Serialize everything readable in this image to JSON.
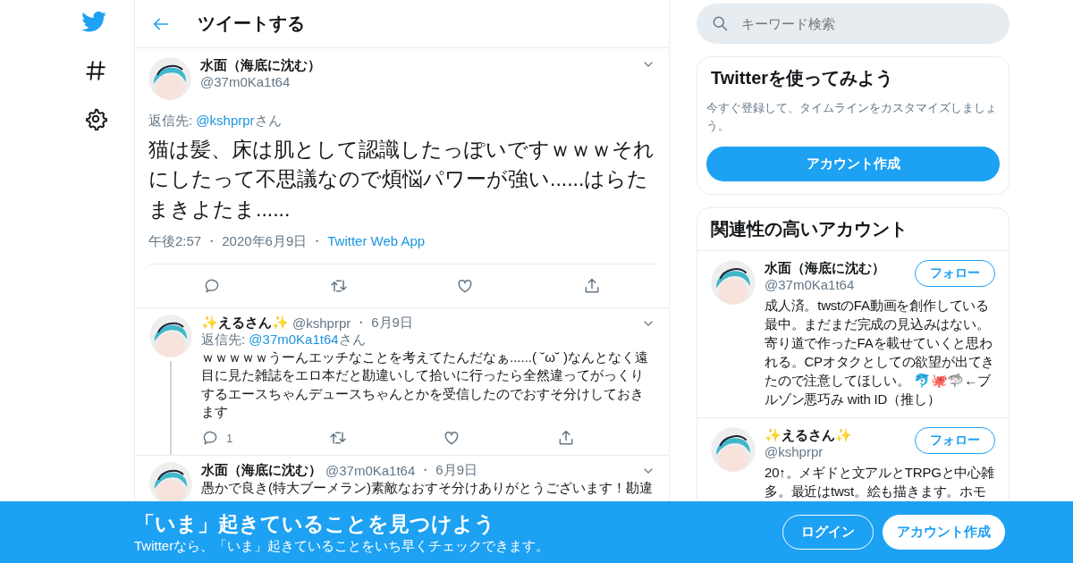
{
  "header": {
    "title": "ツイートする"
  },
  "separator": "・",
  "main_tweet": {
    "name": "水面（海底に沈む）",
    "handle": "@37m0Ka1t64",
    "reply_label": "返信先: ",
    "reply_to": "@kshprpr",
    "reply_suffix": "さん",
    "text": "猫は髪、床は肌として認識したっぽいですｗｗｗそれにしたって不思議なので煩悩パワーが強い......はらたまきよたま......",
    "time": "午後2:57",
    "date": "2020年6月9日",
    "source": "Twitter Web App"
  },
  "replies": [
    {
      "name": "✨えるさん✨",
      "handle": "@kshprpr",
      "date": "6月9日",
      "reply_label": "返信先: ",
      "reply_to": "@37m0Ka1t64",
      "reply_suffix": "さん",
      "text": "ｗｗｗｗｗうーんエッチなことを考えてたんだなぁ......( ˘ω˘ )なんとなく遠目に見た雑誌をエロ本だと勘違いして拾いに行ったら全然違ってがっくりするエースちゃんデュースちゃんとかを受信したのでおすそ分けしておきます",
      "reply_count": "1",
      "thread": true
    },
    {
      "name": "水面（海底に沈む）",
      "handle": "@37m0Ka1t64",
      "date": "6月9日",
      "text": "愚かで良き(特大ブーメラン)素敵なおすそ分けありがとうございます！勘違",
      "thread": false
    }
  ],
  "search": {
    "placeholder": "キーワード検索"
  },
  "signup_card": {
    "title": "Twitterを使ってみよう",
    "text": "今すぐ登録して、タイムラインをカスタマイズしましょう。",
    "button": "アカウント作成"
  },
  "related": {
    "title": "関連性の高いアカウント",
    "accounts": [
      {
        "name": "水面（海底に沈む）",
        "handle": "@37m0Ka1t64",
        "button": "フォロー",
        "bio": "成人済。twstのFA動画を創作している最中。まだまだ完成の見込みはない。寄り道で作ったFAを載せていくと思われる。CPオタクとしての欲望が出てきたので注意してほしい。 🐬🐙🦈←ブルゾン悪巧み with ID（推し）"
      },
      {
        "name": "✨えるさん✨",
        "handle": "@kshprpr",
        "button": "フォロー",
        "bio": "20↑。メギドと文アルとTRPGと中心雑多。最近はtwst。絵も描きます。ホモ"
      }
    ]
  },
  "banner": {
    "title": "「いま」起きていることを見つけよう",
    "text": "Twitterなら、「いま」起きていることをいち早くチェックできます。",
    "login": "ログイン",
    "signup": "アカウント作成"
  }
}
